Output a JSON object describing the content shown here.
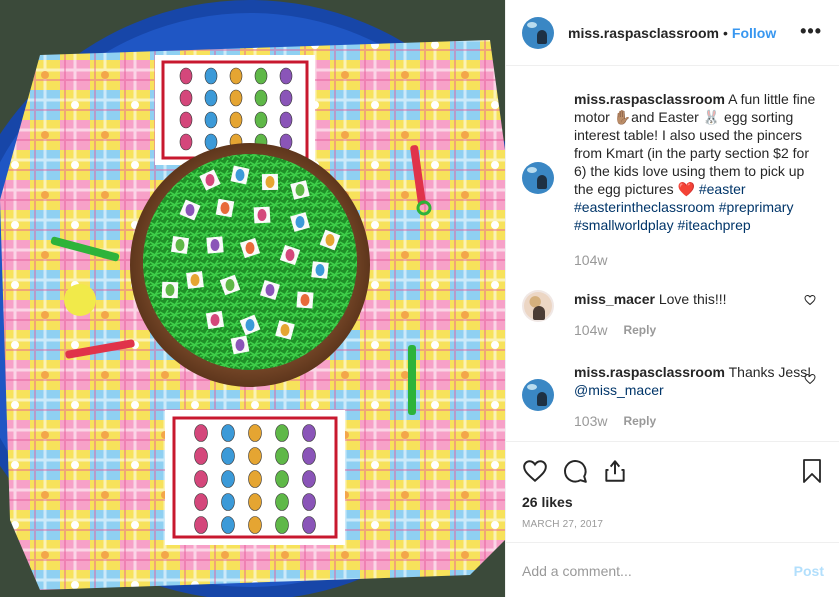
{
  "post": {
    "username": "miss.raspasclassroom",
    "follow_label": "Follow",
    "more_label": "•••",
    "separator": "•"
  },
  "photo": {
    "alt": "Easter egg sorting tray",
    "colors": {
      "tray": "#1746a8",
      "table_cloth_pink": "#f06ba8",
      "table_cloth_yellow": "#f4e04a",
      "table_cloth_blue": "#7cc6f0",
      "bowl": "#8c5a35",
      "grass": "#23a52f",
      "card_border": "#c8182f"
    }
  },
  "comments": [
    {
      "username": "miss.raspasclassroom",
      "text_parts": [
        "A fun little fine motor ✋🏽and Easter 🐰 egg sorting interest table! I also used the pincers from Kmart (in the party section $2 for 6) the kids love using them to pick up the egg pictures ❤️ "
      ],
      "hashtags": [
        "#easter",
        "#easterintheclassroom",
        "#preprimary",
        "#smallworldplay",
        "#iteachprep"
      ],
      "time": "104w"
    },
    {
      "username": "miss_macer",
      "text": "Love this!!!",
      "time": "104w",
      "reply_label": "Reply"
    },
    {
      "username": "miss.raspasclassroom",
      "text": "Thanks Jess! ",
      "mention": "@miss_macer",
      "time": "103w",
      "reply_label": "Reply"
    }
  ],
  "actions": {
    "like_icon": "heart-icon",
    "comment_icon": "comment-icon",
    "share_icon": "share-icon",
    "save_icon": "bookmark-icon",
    "likes_text": "26 likes",
    "date_text": "MARCH 27, 2017"
  },
  "add_comment": {
    "placeholder": "Add a comment...",
    "post_label": "Post"
  }
}
